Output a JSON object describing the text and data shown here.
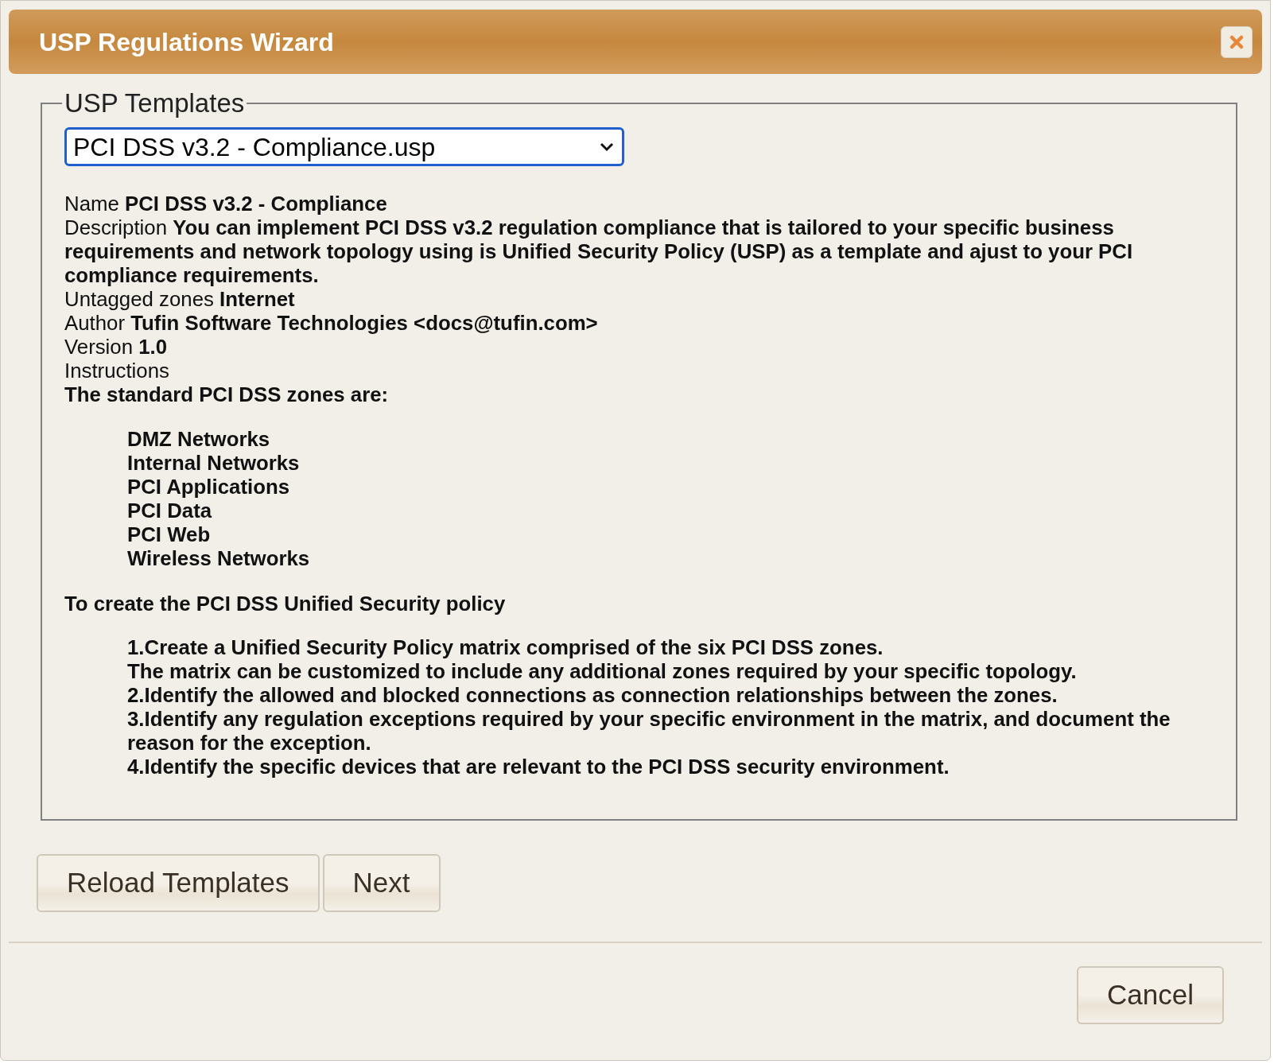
{
  "window": {
    "title": "USP Regulations Wizard"
  },
  "templates": {
    "legend": "USP Templates",
    "selected_template": "PCI DSS v3.2 - Compliance.usp",
    "fields": [
      {
        "label": "Name",
        "value": "PCI DSS v3.2 - Compliance"
      },
      {
        "label": "Description",
        "value": "You can implement PCI DSS v3.2 regulation compliance that is tailored to your specific business requirements and network topology using is Unified Security Policy (USP) as a template and ajust to your PCI compliance requirements."
      },
      {
        "label": "Untagged zones",
        "value": "Internet"
      },
      {
        "label": "Author",
        "value": "Tufin Software Technologies <docs@tufin.com>"
      },
      {
        "label": "Version",
        "value": "1.0"
      }
    ],
    "instructions": {
      "label": "Instructions",
      "heading": "The standard PCI DSS zones are:",
      "zones": [
        "DMZ Networks",
        "Internal Networks",
        "PCI Applications",
        "PCI Data",
        "PCI Web",
        "Wireless Networks"
      ],
      "subheading": "To create the PCI DSS Unified Security policy",
      "steps": [
        "1.Create a Unified Security Policy matrix comprised of the six PCI DSS zones.",
        "The matrix can be customized to include any additional zones required by your specific topology.",
        "2.Identify the allowed and blocked connections as connection relationships between the zones.",
        "3.Identify any regulation exceptions required by your specific environment in the matrix, and document the reason for the exception.",
        "4.Identify the specific devices that are relevant to the PCI DSS security environment."
      ]
    }
  },
  "buttons": [
    "Reload Templates",
    "Next"
  ],
  "footer_buttons": [
    "Cancel"
  ]
}
